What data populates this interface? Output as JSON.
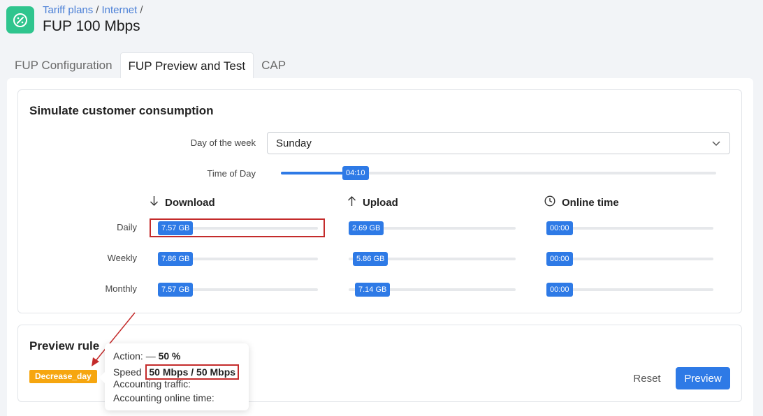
{
  "header": {
    "breadcrumb": [
      "Tariff plans",
      "Internet"
    ],
    "breadcrumb_sep": "/",
    "title": "FUP 100 Mbps",
    "icon": "percent-icon"
  },
  "tabs": [
    {
      "label": "FUP Configuration",
      "active": false
    },
    {
      "label": "FUP Preview and Test",
      "active": true
    },
    {
      "label": "CAP",
      "active": false
    }
  ],
  "simulate": {
    "title": "Simulate customer consumption",
    "day_label": "Day of the week",
    "day_value": "Sunday",
    "time_label": "Time of Day",
    "time_value": "04:10",
    "time_fraction": 0.15,
    "columns": [
      {
        "label": "Download",
        "icon": "arrow-down-icon"
      },
      {
        "label": "Upload",
        "icon": "arrow-up-icon"
      },
      {
        "label": "Online time",
        "icon": "clock-icon"
      }
    ],
    "rows": [
      {
        "label": "Daily",
        "download": "7.57 GB",
        "upload": "2.69 GB",
        "online": "00:00"
      },
      {
        "label": "Weekly",
        "download": "7.86 GB",
        "upload": "5.86 GB",
        "online": "00:00"
      },
      {
        "label": "Monthly",
        "download": "7.57 GB",
        "upload": "7.14 GB",
        "online": "00:00"
      }
    ]
  },
  "preview": {
    "title": "Preview rule",
    "tag": "Decrease_day",
    "tooltip": {
      "action_label": "Action:",
      "action_symbol": "—",
      "action_value": "50 %",
      "speed_label": "Speed",
      "speed_value": "50 Mbps / 50 Mbps",
      "accounting_traffic_label": "Accounting traffic:",
      "accounting_online_label": "Accounting online time:"
    },
    "reset_label": "Reset",
    "preview_label": "Preview"
  },
  "colors": {
    "accent": "#2e7ae6",
    "brand": "#2fc58e",
    "tag": "#f6a60f",
    "highlight": "#c42b2b"
  }
}
